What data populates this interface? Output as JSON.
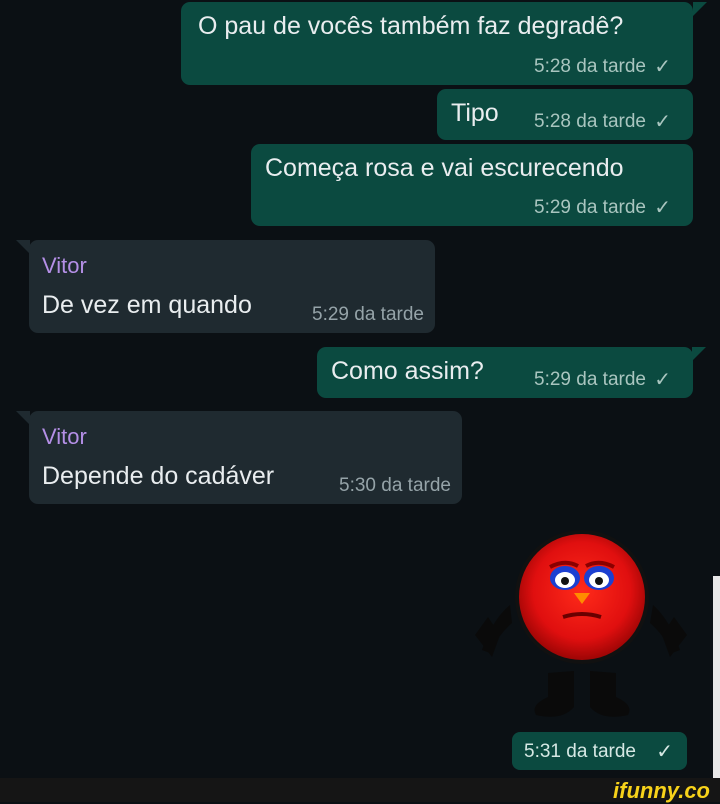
{
  "messages": [
    {
      "text": "O pau de vocês também faz degradê?",
      "time": "5:28 da tarde",
      "check": "✓"
    },
    {
      "text": "Tipo",
      "time": "5:28 da tarde",
      "check": "✓"
    },
    {
      "text": "Começa rosa e vai escurecendo",
      "time": "5:29 da tarde",
      "check": "✓"
    },
    {
      "sender": "Vitor",
      "text": "De vez em quando",
      "time": "5:29 da tarde"
    },
    {
      "text": "Como assim?",
      "time": "5:29 da tarde",
      "check": "✓"
    },
    {
      "sender": "Vitor",
      "text": "Depende do cadáver",
      "time": "5:30 da tarde"
    }
  ],
  "sticker": {
    "icon": "red-blushing-emoji-sticker",
    "time": "5:31 da tarde",
    "check": "✓"
  },
  "watermark": "ifunny.co"
}
